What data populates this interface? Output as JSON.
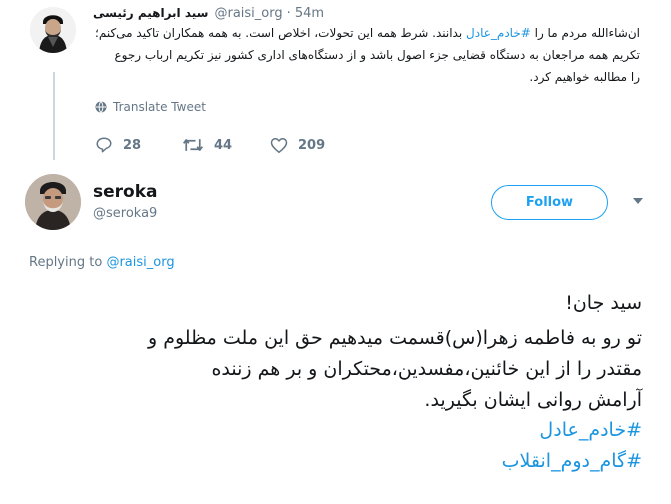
{
  "prev_tweet": {
    "author_name": "سید ابراهیم رئیسی",
    "handle": "@raisi_org",
    "time": "· 54m",
    "lines": [
      {
        "pre": "ان‌شاءالله مردم ما را ",
        "link": "#خادم_عادل",
        "post": " بدانند. شرط همه این تحولات، اخلاص است. به همه همکاران تاکید می‌کنم؛"
      },
      {
        "pre": "تکریم همه مراجعان به دستگاه قضایی جزء اصول باشد و از دستگاه‌های اداری کشور نیز تکریم ارباب رجوع",
        "link": "",
        "post": ""
      },
      {
        "pre": "را مطالبه خواهیم کرد.",
        "link": "",
        "post": ""
      }
    ],
    "translate_label": "Translate Tweet",
    "reply_count": "28",
    "retweet_count": "44",
    "like_count": "209"
  },
  "reply_tweet": {
    "author_name": "seroka",
    "handle": "@seroka9",
    "follow_label": "Follow",
    "replying_prefix": "Replying to",
    "replying_handle": "@raisi_org",
    "lines": [
      "سید جان!",
      "تو رو به فاطمه زهرا(س)قسمت میدهیم حق این ملت مظلوم و",
      "مقتدر را از این خائنین،مفسدین،محتکران و بر هم زننده",
      "آرامش روانی ایشان بگیرید."
    ],
    "hashtags": [
      "#خادم_عادل",
      "#گام_دوم_انقلاب"
    ]
  },
  "colors": {
    "link": "#1b95e0",
    "accent": "#1da1f2",
    "muted": "#657786",
    "text": "#14171a"
  },
  "icons": [
    "translate-globe-icon",
    "reply-icon",
    "retweet-icon",
    "like-icon",
    "chevron-down-icon"
  ]
}
